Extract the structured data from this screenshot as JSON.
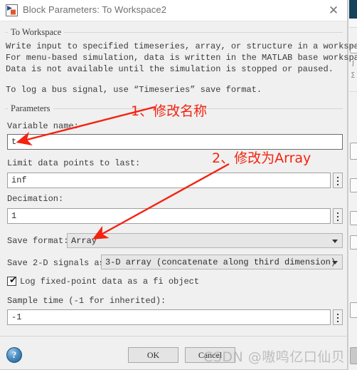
{
  "window": {
    "title": "Block Parameters: To Workspace2",
    "icon": "simulink-block-icon",
    "close_icon": "close-icon"
  },
  "description_group": {
    "legend": "To Workspace",
    "line1": "Write input to specified timeseries, array, or structure in a workspace.",
    "line2": "For menu-based simulation, data is written in the MATLAB base workspace.",
    "line3": "Data is not available until the simulation is stopped or paused.",
    "line4": "To log a bus signal, use “Timeseries” save format."
  },
  "parameters_group": {
    "legend": "Parameters",
    "variable_name": {
      "label": "Variable name:",
      "value": "t"
    },
    "limit_data_points": {
      "label": "Limit data points to last:",
      "value": "inf",
      "button_icon": "vertical-dots-icon"
    },
    "decimation": {
      "label": "Decimation:",
      "value": "1",
      "button_icon": "vertical-dots-icon"
    },
    "save_format": {
      "label": "Save format:",
      "value": "Array",
      "arrow_icon": "chevron-down-icon"
    },
    "save_2d_signals": {
      "label": "Save 2-D signals as:",
      "value": "3-D array (concatenate along third dimension)",
      "arrow_icon": "chevron-down-icon"
    },
    "log_fixed_point": {
      "label": "Log fixed-point data as a fi object",
      "checked": "✔"
    },
    "sample_time": {
      "label": "Sample time (-1 for inherited):",
      "value": "-1",
      "button_icon": "vertical-dots-icon"
    }
  },
  "footer": {
    "help_icon": "?",
    "ok_label": "OK",
    "cancel_label": "Cancel"
  },
  "annotations": {
    "note1": "1、修改名称",
    "note2": "2、修改为Array",
    "arrow_color": "#f5220f"
  },
  "watermark": {
    "text": "CSDN @嗷鸣亿口仙贝"
  }
}
